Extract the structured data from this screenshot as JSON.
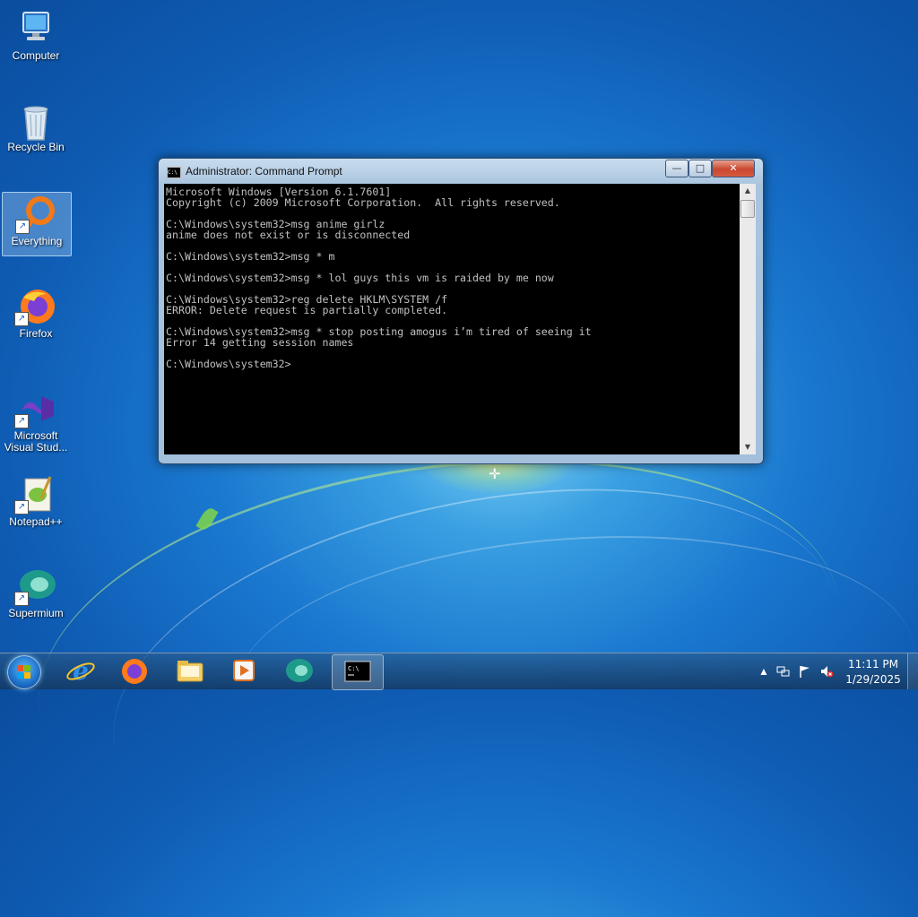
{
  "desktop": {
    "icons": [
      {
        "label": "Computer",
        "icon": "computer-icon"
      },
      {
        "label": "Recycle Bin",
        "icon": "recycle-bin-icon"
      },
      {
        "label": "Everything",
        "icon": "everything-icon"
      },
      {
        "label": "Firefox",
        "icon": "firefox-icon"
      },
      {
        "label": "Microsoft Visual Stud...",
        "icon": "visual-studio-icon"
      },
      {
        "label": "Notepad++",
        "icon": "notepadpp-icon"
      },
      {
        "label": "Supermium",
        "icon": "supermium-icon"
      }
    ]
  },
  "window": {
    "title": "Administrator: Command Prompt",
    "icon_text": "C:\\",
    "minimize": "—",
    "maximize": "□",
    "close": "✕",
    "console_lines": [
      "Microsoft Windows [Version 6.1.7601]",
      "Copyright (c) 2009 Microsoft Corporation.  All rights reserved.",
      "",
      "C:\\Windows\\system32>msg anime girlz",
      "anime does not exist or is disconnected",
      "",
      "C:\\Windows\\system32>msg * m",
      "",
      "C:\\Windows\\system32>msg * lol guys this vm is raided by me now",
      "",
      "C:\\Windows\\system32>reg delete HKLM\\SYSTEM /f",
      "ERROR: Delete request is partially completed.",
      "",
      "C:\\Windows\\system32>msg * stop posting amogus i’m tired of seeing it",
      "Error 14 getting session names",
      "",
      "C:\\Windows\\system32>"
    ]
  },
  "taskbar": {
    "start": "start-orb-icon",
    "pinned": [
      "internet-explorer-icon",
      "firefox-icon",
      "file-explorer-icon",
      "media-player-icon",
      "supermium-icon",
      "command-prompt-icon"
    ],
    "tray": {
      "show_hidden": "▲",
      "time": "11:11 PM",
      "date": "1/29/2025"
    }
  },
  "colors": {
    "console_bg": "#000000",
    "console_fg": "#c0c0c0",
    "close_button": "#c9472f"
  }
}
